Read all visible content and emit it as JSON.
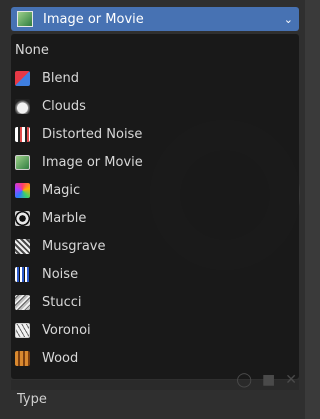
{
  "dropdown": {
    "selected_label": "Image or Movie",
    "icon": "image-or-movie-texture-icon",
    "chevron_icon": "chevron-down-icon"
  },
  "menu": {
    "items": [
      {
        "label": "None",
        "icon": ""
      },
      {
        "label": "Blend",
        "icon": "blend-texture-icon"
      },
      {
        "label": "Clouds",
        "icon": "clouds-texture-icon"
      },
      {
        "label": "Distorted Noise",
        "icon": "distorted-noise-texture-icon"
      },
      {
        "label": "Image or Movie",
        "icon": "image-or-movie-texture-icon"
      },
      {
        "label": "Magic",
        "icon": "magic-texture-icon"
      },
      {
        "label": "Marble",
        "icon": "marble-texture-icon"
      },
      {
        "label": "Musgrave",
        "icon": "musgrave-texture-icon"
      },
      {
        "label": "Noise",
        "icon": "noise-texture-icon"
      },
      {
        "label": "Stucci",
        "icon": "stucci-texture-icon"
      },
      {
        "label": "Voronoi",
        "icon": "voronoi-texture-icon"
      },
      {
        "label": "Wood",
        "icon": "wood-texture-icon"
      }
    ]
  },
  "footer": {
    "type_label": "Type"
  },
  "colors": {
    "accent": "#4772b3",
    "menu_bg": "#181818",
    "text": "#d8d8d8"
  }
}
